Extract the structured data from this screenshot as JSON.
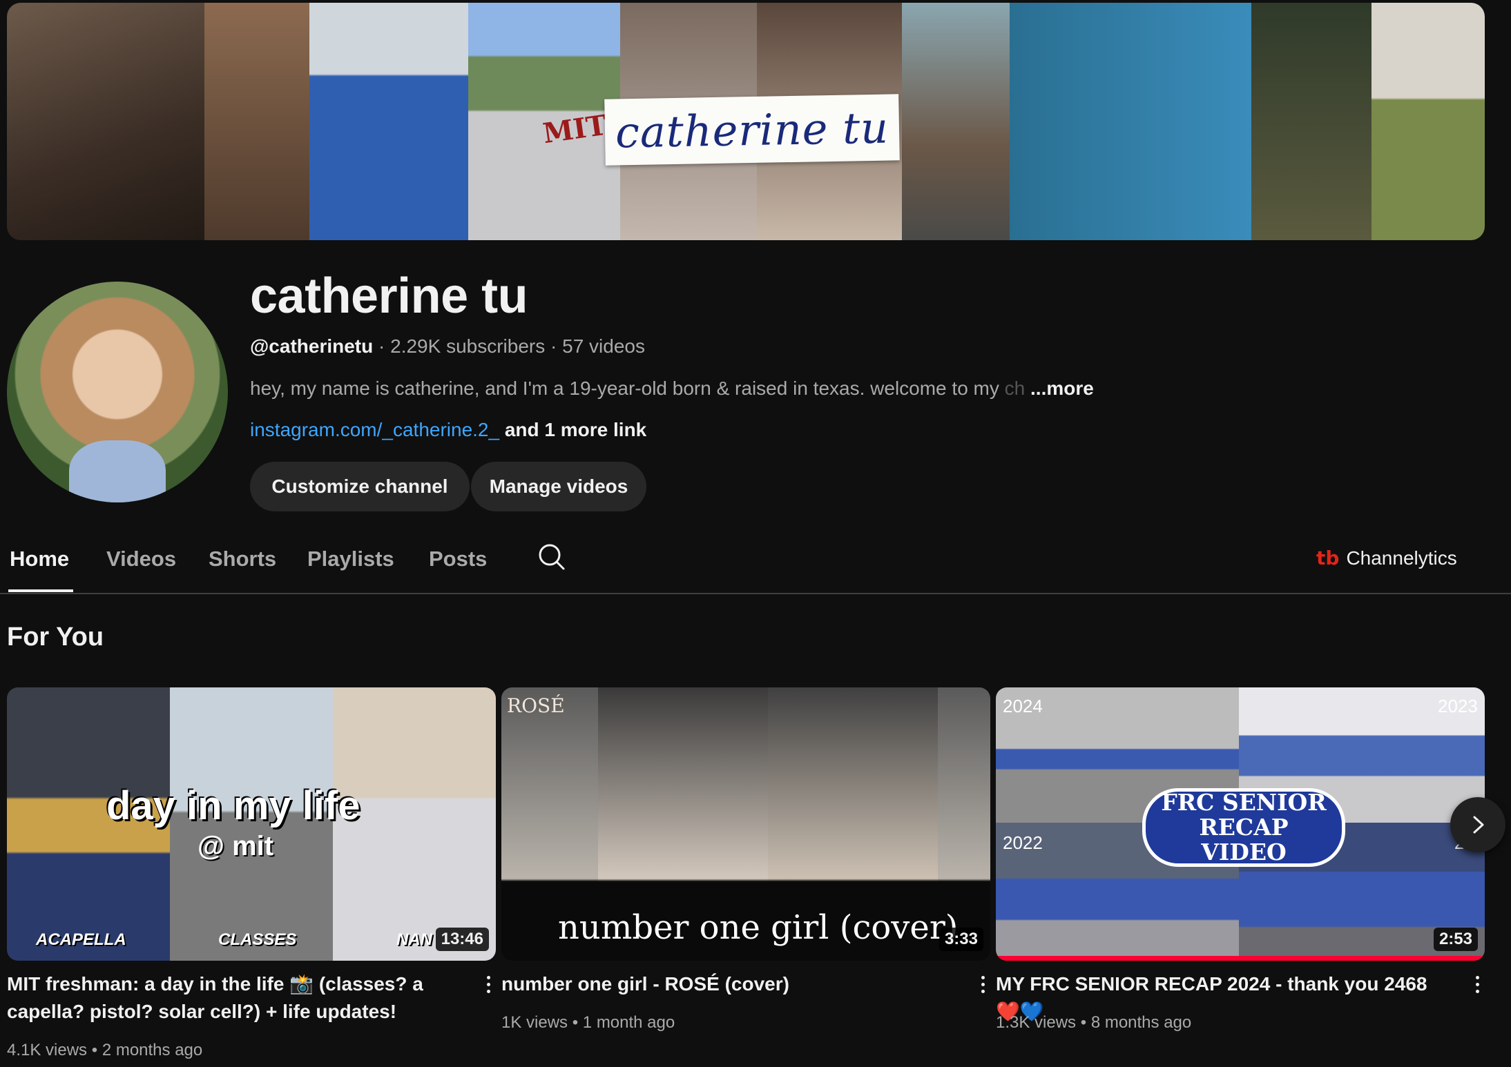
{
  "banner": {
    "title": "catherine tu",
    "shirt_text": "MIT",
    "colors": [
      "#5a4a3e",
      "#8c6a50",
      "#3b6ea8",
      "#a8c4e8",
      "#b7a79a",
      "#6b5444",
      "#2d6b8c",
      "#3a86b8",
      "#4a4a3a",
      "#6d7d4a"
    ]
  },
  "channel": {
    "name": "catherine tu",
    "handle": "@catherinetu",
    "separator": "·",
    "subscribers": "2.29K subscribers",
    "videos": "57 videos",
    "description": "hey, my name is catherine, and I'm a 19-year-old born & raised in texas. welcome to my",
    "description_fade": "ch",
    "more": "...more",
    "link": "instagram.com/_catherine.2_",
    "more_links": "and 1 more link",
    "customize_label": "Customize channel",
    "manage_label": "Manage videos"
  },
  "tabs": [
    {
      "label": "Home",
      "active": true
    },
    {
      "label": "Videos",
      "active": false
    },
    {
      "label": "Shorts",
      "active": false
    },
    {
      "label": "Playlists",
      "active": false
    },
    {
      "label": "Posts",
      "active": false
    }
  ],
  "channelytics": {
    "logo": "tb",
    "label": "Channelytics"
  },
  "section_title": "For You",
  "videos": [
    {
      "title": "MIT freshman: a day in the life 📸 (classes? a capella? pistol? solar cell?) + life updates!",
      "views": "4.1K views",
      "dot": "•",
      "age": "2 months ago",
      "duration": "13:46",
      "overlay_main": "day in my life",
      "overlay_sub": "@ mit",
      "overlay_labels": [
        "ACAPELLA",
        "CLASSES",
        "NAN"
      ]
    },
    {
      "title": "number one girl - ROSÉ (cover)",
      "views": "1K views",
      "dot": "•",
      "age": "1 month ago",
      "duration": "3:33",
      "overlay_main": "number one girl (cover)",
      "overlay_tag": "ROSÉ"
    },
    {
      "title": "MY FRC SENIOR RECAP 2024 - thank you 2468 ❤️💙",
      "views": "1.3K views",
      "dot": "•",
      "age": "8 months ago",
      "duration": "2:53",
      "overlay_main": "FRC SENIOR RECAP VIDEO",
      "years": [
        "2024",
        "2023",
        "2022",
        "20"
      ]
    }
  ]
}
